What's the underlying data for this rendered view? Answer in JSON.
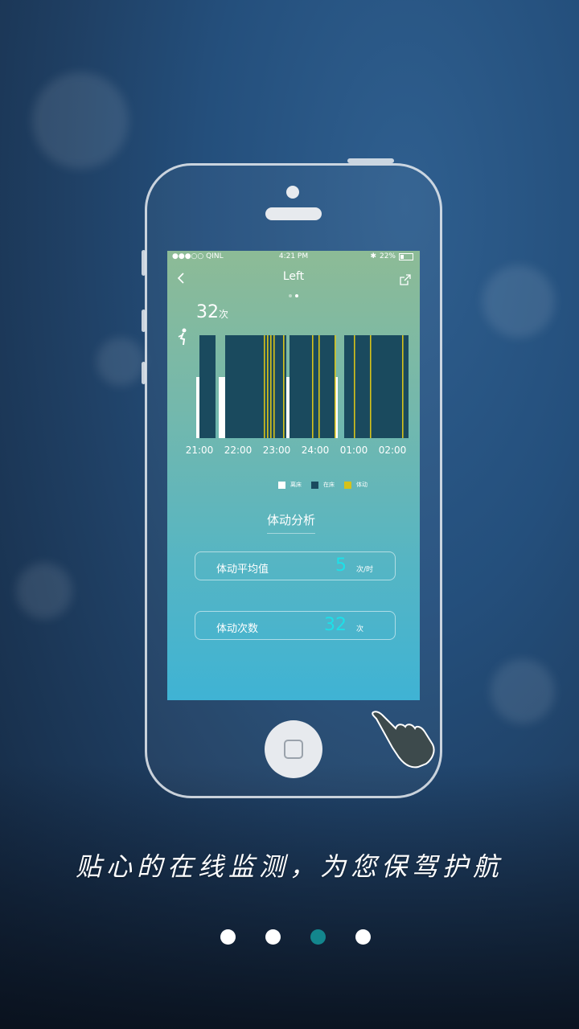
{
  "slogan": "贴心的在线监测，为您保驾护航",
  "pager": {
    "count": 4,
    "active_index": 2
  },
  "colors": {
    "accent": "#13868d",
    "away": "#ffffff",
    "in_bed": "#1a4a5e",
    "movement": "#d6c21a",
    "value": "#1ee0e8"
  },
  "status_bar": {
    "carrier": "●●●○○ QINL",
    "time": "4:21 PM",
    "battery": "22%"
  },
  "nav": {
    "back_icon": "chevron-left-icon",
    "title": "Left",
    "share_icon": "share-icon"
  },
  "summary": {
    "count_value": "32",
    "count_unit": "次"
  },
  "chart_data": {
    "type": "bar",
    "x_ticks": [
      "21:00",
      "22:00",
      "23:00",
      "24:00",
      "01:00",
      "02:00"
    ],
    "legend": [
      {
        "name": "离床",
        "color": "#ffffff"
      },
      {
        "name": "在床",
        "color": "#1a4a5e"
      },
      {
        "name": "体动",
        "color": "#d6c21a"
      }
    ],
    "in_bed_periods": [
      [
        "21:00",
        "21:25"
      ],
      [
        "21:40",
        "23:15"
      ],
      [
        "23:20",
        "24:30"
      ],
      [
        "24:45",
        "02:25"
      ]
    ],
    "away_periods": [
      [
        "20:55",
        "21:00"
      ],
      [
        "21:30",
        "21:40"
      ],
      [
        "23:15",
        "23:20"
      ],
      [
        "24:30",
        "24:35"
      ]
    ],
    "movement_events": [
      "22:40",
      "22:45",
      "22:50",
      "22:55",
      "23:10",
      "23:55",
      "24:05",
      "24:30",
      "01:00",
      "01:25",
      "02:15"
    ]
  },
  "analysis": {
    "title": "体动分析",
    "avg": {
      "label": "体动平均值",
      "value": "5",
      "unit": "次/时"
    },
    "total": {
      "label": "体动次数",
      "value": "32",
      "unit": "次"
    }
  }
}
